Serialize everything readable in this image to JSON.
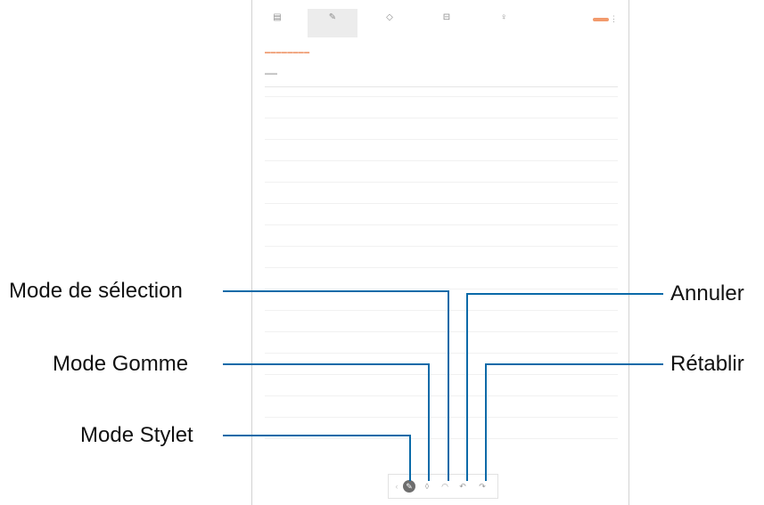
{
  "callouts": {
    "mode_selection": "Mode de sélection",
    "mode_gomme": "Mode Gomme",
    "mode_stylet": "Mode Stylet",
    "annuler": "Annuler",
    "retablir": "Rétablir"
  },
  "colors": {
    "leader_line": "#0a6aa8",
    "accent": "#f29a6c"
  },
  "toolbar_icons": [
    "text-icon",
    "handwriting-icon",
    "drawing-icon",
    "image-icon",
    "voice-icon"
  ],
  "pen_toolbar_icons": [
    "pen-icon",
    "eraser-icon",
    "selection-icon",
    "undo-icon",
    "redo-icon"
  ]
}
